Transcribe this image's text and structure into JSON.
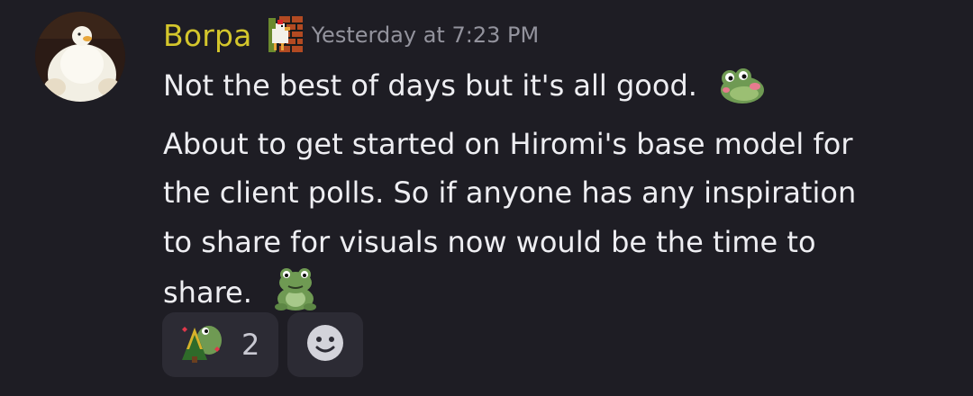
{
  "message": {
    "author": "Borpa",
    "timestamp": "Yesterday at 7:23 PM",
    "author_color": "#d4c62c",
    "avatar_icon": "duck-avatar-icon",
    "role_icon": "pixel-bird-brick-icon",
    "lines": [
      "Not the best of days but it's all good.",
      "About to get started on Hiromi's base model for",
      "the client polls. So if anyone has any inspiration",
      "to share for visuals now would be the time to",
      "share."
    ],
    "emojis": [
      "blushing-frog-emoji",
      "sitting-frog-emoji"
    ]
  },
  "reactions": [
    {
      "emoji": "frog-christmas-tree-emoji",
      "count": "2"
    }
  ],
  "add_reaction_icon": "smiley-add-reaction-icon",
  "colors": {
    "background": "#1e1d24",
    "reaction_bg": "#2c2b34",
    "timestamp": "#93939d"
  }
}
